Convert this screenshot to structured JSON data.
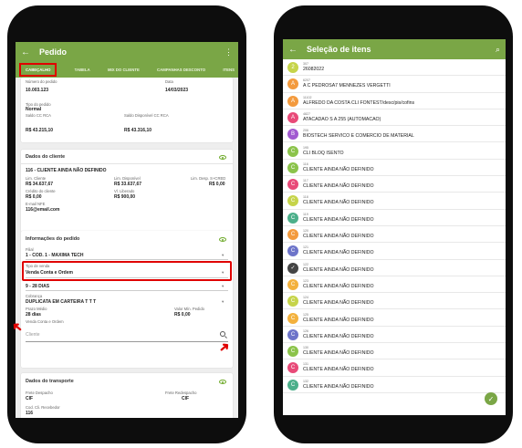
{
  "left": {
    "appbar": {
      "title": "Pedido",
      "back_icon": "arrow-left-icon",
      "more_icon": "more-vertical-icon",
      "back_glyph": "←",
      "more_glyph": "⋮"
    },
    "tabs": [
      {
        "label": "CABEÇALHO",
        "active": true
      },
      {
        "label": "TABELA"
      },
      {
        "label": "MIX DO CLIENTE"
      },
      {
        "label": "CAMPANHAS DESCONTO"
      },
      {
        "label": "ITENS"
      }
    ],
    "header_card": {
      "numero_label": "Número do pedido",
      "numero_value": "10.003.123",
      "data_label": "Data",
      "data_value": "14/03/2023",
      "tipo_label": "Tipo do pedido",
      "tipo_value": "Normal",
      "saldo_rca_label": "Saldo CC RCA",
      "saldo_rca_value": "R$ 43.215,10",
      "saldo_disp_label": "Saldo Disponível CC RCA",
      "saldo_disp_value": "R$ 43.316,10"
    },
    "cliente_card": {
      "title": "Dados do cliente",
      "name": "116 - CLIENTE AINDA NÃO DEFINIDO",
      "lim_cliente_label": "Lim. Cliente",
      "lim_cliente_value": "R$ 34.637,67",
      "lim_disp_label": "Lim. Disponível",
      "lim_disp_value": "R$ 33.637,67",
      "lim_desp_label": "Lim. Desp. S+CRED",
      "lim_desp_value": "R$ 0,00",
      "credito_label": "Crédito do cliente",
      "credito_value": "R$ 0,00",
      "vl_liberado_label": "Vl. Liberado",
      "vl_liberado_value": "R$ 900,00",
      "email_label": "E-mail NFE",
      "email_value": "116@email.com"
    },
    "pedido_card": {
      "title": "Informações do pedido",
      "filial_label": "Filial",
      "filial_value": "1 - COD. 1 - MAXIMA TECH",
      "tipo_venda_label": "Tipo de venda",
      "tipo_venda_value": "Venda Conta e Ordem",
      "plano_value": "9 - 28 DIAS",
      "cobranca_label": "Cobrança",
      "cobranca_value": "DUPLICATA EM CARTEIRA T T T",
      "prazo_label": "Prazo Médio",
      "prazo_value": "28 dias",
      "valor_min_label": "Valor Mín. Pedido",
      "valor_min_value": "R$ 0,00",
      "venda_co_label": "Venda Conta e Ordem",
      "cliente_placeholder": "Cliente"
    },
    "transporte_card": {
      "title": "Dados do transporte",
      "frete_desp_label": "Frete Despacho",
      "frete_desp_value": "CIF",
      "frete_red_label": "Frete Redespacho",
      "frete_red_value": "CIF",
      "cod_label": "Cod. Cli. Recebedor",
      "cod_value": "116"
    }
  },
  "right": {
    "appbar": {
      "title": "Seleção de itens",
      "back_icon": "arrow-left-icon",
      "search_icon": "search-icon",
      "back_glyph": "←",
      "search_glyph": "⌕"
    },
    "items": [
      {
        "letter": "2",
        "color": "#c6d44a",
        "code": "307",
        "name": "26082022"
      },
      {
        "letter": "A",
        "color": "#f39a3d",
        "code": "6207",
        "name": "A C PEDROSA7 MENNEZES VERGETTI"
      },
      {
        "letter": "A",
        "color": "#f39a3d",
        "code": "11102",
        "name": "ALFREDO DA COSTA CLI FONTEST/desc/pis/cofins"
      },
      {
        "letter": "A",
        "color": "#e84a78",
        "code": "4827",
        "name": "ATACADAO S A 255 (AUTOMACAO)"
      },
      {
        "letter": "B",
        "color": "#a159d0",
        "code": "206",
        "name": "BIOSTECH SERVICO E COMERCIO DE MATERIAL"
      },
      {
        "letter": "C",
        "color": "#8bc34a",
        "code": "195",
        "name": "CLI BLOQ ISENTO"
      },
      {
        "letter": "C",
        "color": "#8bc34a",
        "code": "116",
        "name": "CLIENTE AINDA NÃO DEFINIDO"
      },
      {
        "letter": "C",
        "color": "#e84a78",
        "code": "117",
        "name": "CLIENTE AINDA NÃO DEFINIDO"
      },
      {
        "letter": "C",
        "color": "#c6d44a",
        "code": "118",
        "name": "CLIENTE AINDA NÃO DEFINIDO"
      },
      {
        "letter": "C",
        "color": "#4caf8a",
        "code": "119",
        "name": "CLIENTE AINDA NÃO DEFINIDO"
      },
      {
        "letter": "C",
        "color": "#f39a3d",
        "code": "120",
        "name": "CLIENTE AINDA NÃO DEFINIDO"
      },
      {
        "letter": "C",
        "color": "#6d74c9",
        "code": "121",
        "name": "CLIENTE AINDA NÃO DEFINIDO"
      },
      {
        "letter": "✓",
        "color": "#444444",
        "code": "122",
        "name": "CLIENTE AINDA NÃO DEFINIDO"
      },
      {
        "letter": "C",
        "color": "#f3b13d",
        "code": "123",
        "name": "CLIENTE AINDA NÃO DEFINIDO"
      },
      {
        "letter": "C",
        "color": "#c6d44a",
        "code": "124",
        "name": "CLIENTE AINDA NÃO DEFINIDO"
      },
      {
        "letter": "C",
        "color": "#f3b13d",
        "code": "125",
        "name": "CLIENTE AINDA NÃO DEFINIDO"
      },
      {
        "letter": "C",
        "color": "#6d74c9",
        "code": "126",
        "name": "CLIENTE AINDA NÃO DEFINIDO"
      },
      {
        "letter": "C",
        "color": "#8bc34a",
        "code": "130",
        "name": "CLIENTE AINDA NÃO DEFINIDO"
      },
      {
        "letter": "C",
        "color": "#e84a78",
        "code": "131",
        "name": "CLIENTE AINDA NÃO DEFINIDO"
      },
      {
        "letter": "C",
        "color": "#4caf8a",
        "code": "132",
        "name": "CLIENTE AINDA NÃO DEFINIDO"
      }
    ],
    "fab_icon": "check-icon",
    "fab_glyph": "✓"
  },
  "colors": {
    "accent": "#7aa646",
    "highlight": "#e00000",
    "eye": "#6eaa2a"
  }
}
